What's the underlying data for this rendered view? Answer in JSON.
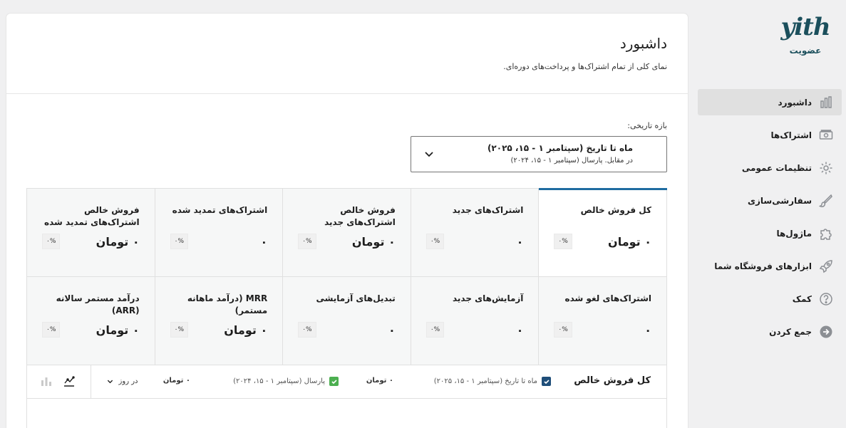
{
  "sidebar": {
    "logo_mark": "yith",
    "logo_sub": "عضویت",
    "items": [
      {
        "label": "داشبورد",
        "icon": "bar-chart-icon",
        "active": true
      },
      {
        "label": "اشتراک‌ها",
        "icon": "money-icon"
      },
      {
        "label": "تنظیمات عمومی",
        "icon": "gear-icon"
      },
      {
        "label": "سفارشی‌سازی",
        "icon": "brush-icon"
      },
      {
        "label": "ماژول‌ها",
        "icon": "puzzle-icon"
      },
      {
        "label": "ابزارهای فروشگاه شما",
        "icon": "rocket-icon"
      },
      {
        "label": "کمک",
        "icon": "help-icon"
      },
      {
        "label": "جمع کردن",
        "icon": "collapse-icon"
      }
    ]
  },
  "header": {
    "title": "داشبورد",
    "subtitle": "نمای کلی از تمام اشتراک‌ها و پرداخت‌های دوره‌ای."
  },
  "date_range": {
    "label": "بازه تاریخی:",
    "main": "ماه تا تاریخ (سپتامبر ۱ - ۱۵، ۲۰۲۵)",
    "compare": "در مقابل. پارسال (سپتامبر ۱ - ۱۵، ۲۰۲۴)"
  },
  "stats": [
    {
      "label": "کل فروش خالص",
      "value": "۰ تومان",
      "delta": "۰%",
      "active": true
    },
    {
      "label": "اشتراک‌های جدید",
      "value": "۰",
      "delta": "۰%"
    },
    {
      "label": "فروش خالص اشتراک‌های جدید",
      "value": "۰ تومان",
      "delta": "۰%"
    },
    {
      "label": "اشتراک‌های تمدید شده",
      "value": "۰",
      "delta": "۰%"
    },
    {
      "label": "فروش خالص اشتراک‌های تمدید شده",
      "value": "۰ تومان",
      "delta": "۰%"
    },
    {
      "label": "اشتراک‌های لغو شده",
      "value": "۰",
      "delta": "۰%"
    },
    {
      "label": "آزمایش‌های جدید",
      "value": "۰",
      "delta": "۰%"
    },
    {
      "label": "تبدیل‌های آزمایشی",
      "value": "۰",
      "delta": "۰%"
    },
    {
      "label": "MRR (درآمد ماهانه مستمر)",
      "value": "۰ تومان",
      "delta": "۰%"
    },
    {
      "label": "درآمد مستمر سالانه (ARR)",
      "value": "۰ تومان",
      "delta": "۰%"
    }
  ],
  "chart": {
    "title": "کل فروش خالص",
    "legend_current": "ماه تا تاریخ (سپتامبر ۱ - ۱۵، ۲۰۲۵)",
    "legend_current_value": "۰ تومان",
    "legend_previous": "پارسال (سپتامبر ۱ - ۱۵، ۲۰۲۴)",
    "legend_previous_value": "۰ تومان",
    "interval": "در روز",
    "colors": {
      "current": "#1f4e79",
      "previous": "#4caf50"
    }
  }
}
